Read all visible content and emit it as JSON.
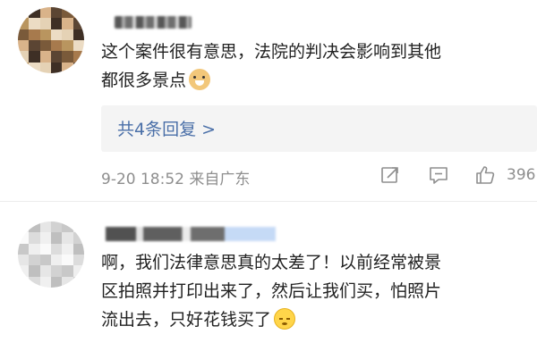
{
  "comments": [
    {
      "text_line1": "这个案件很有意思，法院的判决会影响到其他",
      "text_line2": "都很多景点",
      "emoji": "dog-emoji",
      "reply_link": "共4条回复 >",
      "meta": "9-20 18:52 来自广东",
      "like_count": "396"
    },
    {
      "text_line1": "啊，我们法律意思真的太差了！以前经常被景",
      "text_line2": "区拍照并打印出来了，然后让我们买，怕照片",
      "text_line3": "流出去，只好花钱买了",
      "emoji": "smile-emoji"
    }
  ],
  "icons": {
    "share": "share-icon",
    "comment": "comment-icon",
    "like": "thumbs-up-icon"
  },
  "colors": {
    "link": "#4a6fa8",
    "meta": "#8e8e8e",
    "reply_bg": "#f4f4f4"
  }
}
